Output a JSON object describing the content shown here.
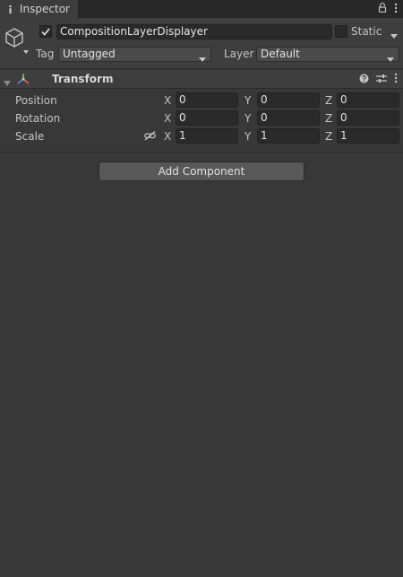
{
  "tab": {
    "title": "Inspector"
  },
  "game_object": {
    "active": true,
    "name": "CompositionLayerDisplayer",
    "static_label": "Static",
    "static": false,
    "tag_label": "Tag",
    "tag_value": "Untagged",
    "layer_label": "Layer",
    "layer_value": "Default"
  },
  "component": {
    "title": "Transform",
    "properties": [
      {
        "label": "Position",
        "x": "0",
        "y": "0",
        "z": "0"
      },
      {
        "label": "Rotation",
        "x": "0",
        "y": "0",
        "z": "0"
      },
      {
        "label": "Scale",
        "x": "1",
        "y": "1",
        "z": "1"
      }
    ],
    "axes": {
      "x": "X",
      "y": "Y",
      "z": "Z"
    }
  },
  "add_component": {
    "label": "Add Component"
  },
  "icons": {
    "tab": "inspector-icon",
    "lock": "lock-icon",
    "menu": "kebab-menu-icon",
    "object": "cube-icon",
    "transform": "transform-icon",
    "help": "help-icon",
    "presets": "sliders-icon",
    "scale_link": "link-icon"
  },
  "colors": {
    "panel": "#383838",
    "header": "#3e3e3e",
    "field": "#2a2a2a",
    "button": "#585858"
  }
}
